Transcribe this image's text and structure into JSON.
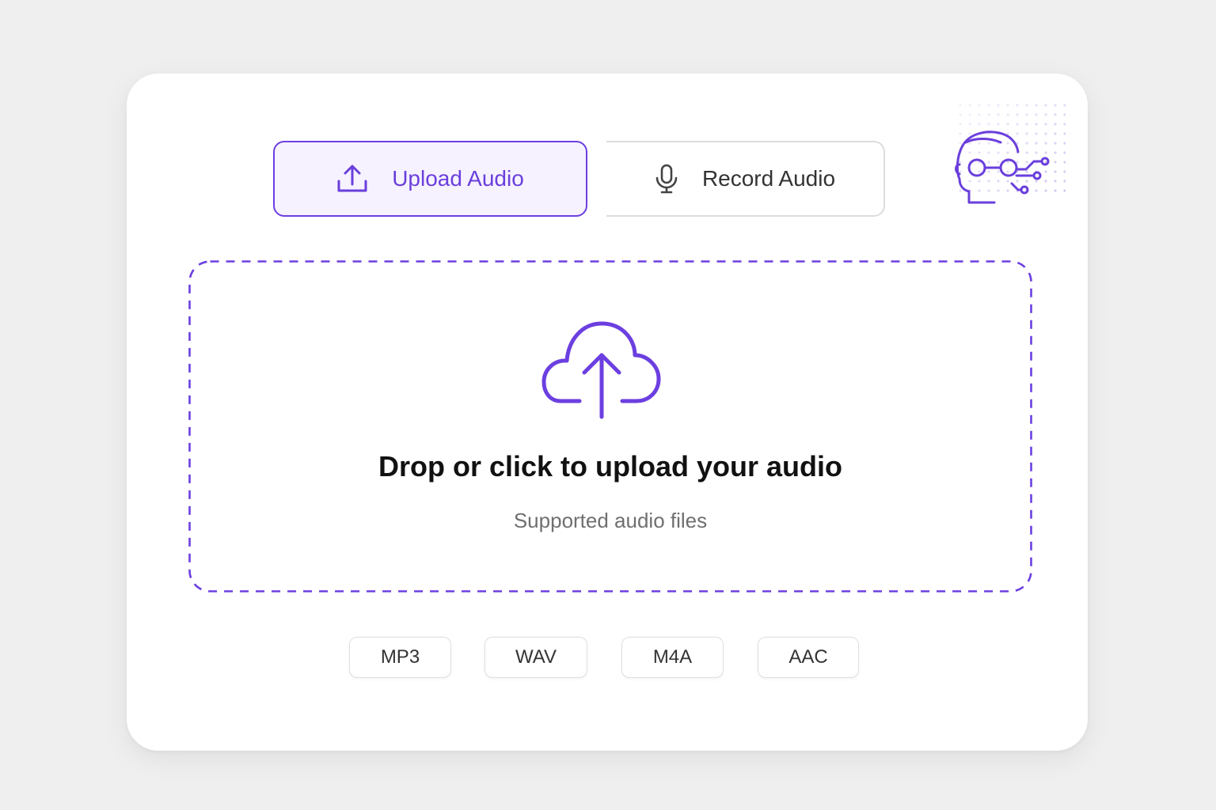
{
  "tabs": {
    "upload": {
      "label": "Upload Audio",
      "icon": "upload-icon",
      "active": true
    },
    "record": {
      "label": "Record Audio",
      "icon": "microphone-icon",
      "active": false
    }
  },
  "dropzone": {
    "title": "Drop or click to upload your audio",
    "subtitle": "Supported audio files",
    "icon": "cloud-upload-icon"
  },
  "formats": [
    "MP3",
    "WAV",
    "M4A",
    "AAC"
  ],
  "decoration": {
    "icon": "ai-robot-head-icon"
  },
  "colors": {
    "accent": "#6c3fe0",
    "accent_bg": "#f6f2ff",
    "background": "#efefef",
    "card": "#ffffff"
  }
}
